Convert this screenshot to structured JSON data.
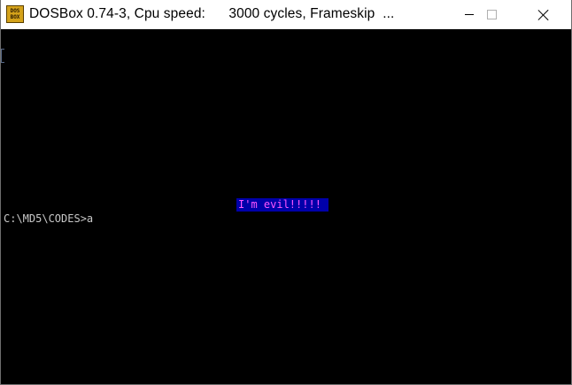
{
  "window": {
    "title": "DOSBox 0.74-3, Cpu speed:      3000 cycles, Frameskip  ...",
    "icon": "dosbox-icon",
    "icon_text": "DOS BOX"
  },
  "screen": {
    "message": "I'm evil!!!!!",
    "prompt": "C:\\MD5\\CODES>a"
  },
  "colors": {
    "screen_bg": "#000000",
    "message_bg": "#0000aa",
    "message_fg": "#ff55ff",
    "prompt_fg": "#c8c8c8"
  }
}
